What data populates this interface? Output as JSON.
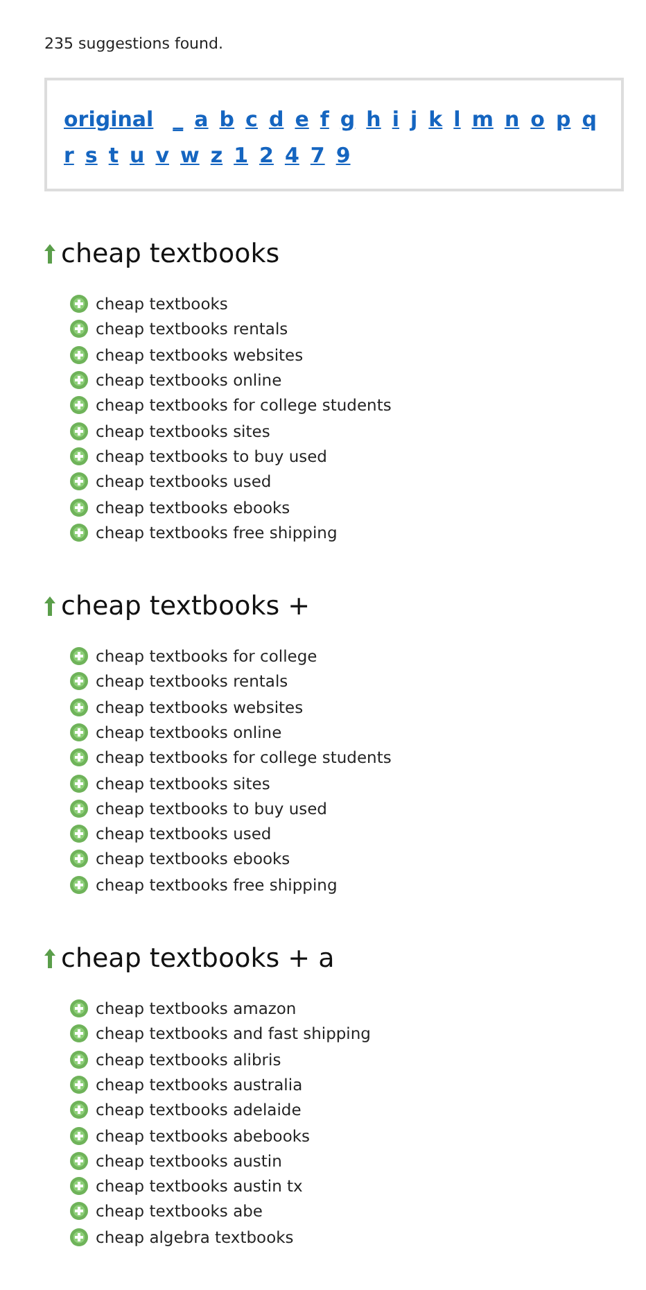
{
  "summary": "235 suggestions found.",
  "letters": [
    "original",
    "_",
    "a",
    "b",
    "c",
    "d",
    "e",
    "f",
    "g",
    "h",
    "i",
    "j",
    "k",
    "l",
    "m",
    "n",
    "o",
    "p",
    "q",
    "r",
    "s",
    "t",
    "u",
    "v",
    "w",
    "z",
    "1",
    "2",
    "4",
    "7",
    "9"
  ],
  "sections": [
    {
      "heading": "cheap textbooks",
      "suggestions": [
        "cheap textbooks",
        "cheap textbooks rentals",
        "cheap textbooks websites",
        "cheap textbooks online",
        "cheap textbooks for college students",
        "cheap textbooks sites",
        "cheap textbooks to buy used",
        "cheap textbooks used",
        "cheap textbooks ebooks",
        "cheap textbooks free shipping"
      ]
    },
    {
      "heading": "cheap textbooks +",
      "suggestions": [
        "cheap textbooks for college",
        "cheap textbooks rentals",
        "cheap textbooks websites",
        "cheap textbooks online",
        "cheap textbooks for college students",
        "cheap textbooks sites",
        "cheap textbooks to buy used",
        "cheap textbooks used",
        "cheap textbooks ebooks",
        "cheap textbooks free shipping"
      ]
    },
    {
      "heading": "cheap textbooks + a",
      "suggestions": [
        "cheap textbooks amazon",
        "cheap textbooks and fast shipping",
        "cheap textbooks alibris",
        "cheap textbooks australia",
        "cheap textbooks adelaide",
        "cheap textbooks abebooks",
        "cheap textbooks austin",
        "cheap textbooks austin tx",
        "cheap textbooks abe",
        "cheap algebra textbooks"
      ]
    }
  ]
}
